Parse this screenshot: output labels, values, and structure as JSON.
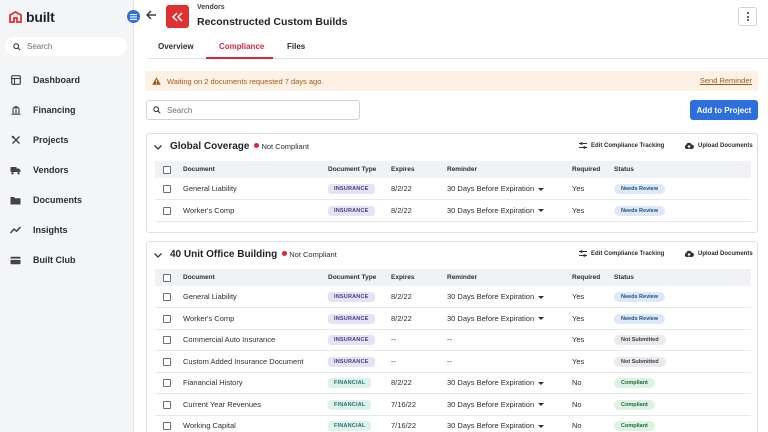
{
  "app": {
    "logo_text": "built"
  },
  "sidebar": {
    "search_placeholder": "Search",
    "items": [
      {
        "label": "Dashboard",
        "icon": "dashboard-icon"
      },
      {
        "label": "Financing",
        "icon": "bank-icon"
      },
      {
        "label": "Projects",
        "icon": "tools-icon"
      },
      {
        "label": "Vendors",
        "icon": "truck-icon"
      },
      {
        "label": "Documents",
        "icon": "folder-icon"
      },
      {
        "label": "Insights",
        "icon": "chart-icon"
      },
      {
        "label": "Built Club",
        "icon": "card-icon"
      }
    ]
  },
  "header": {
    "breadcrumb": "Vendors",
    "title": "Reconstructed Custom Builds"
  },
  "tabs": [
    {
      "label": "Overview",
      "active": false
    },
    {
      "label": "Compliance",
      "active": true
    },
    {
      "label": "Files",
      "active": false
    }
  ],
  "alert": {
    "message": "Waiting on 2 documents requested 7 days ago.",
    "link": "Send Reminder"
  },
  "toolbar": {
    "search_placeholder": "Search",
    "add_label": "Add to Project"
  },
  "columns": [
    "Document",
    "Document Type",
    "Expires",
    "Reminder",
    "Required",
    "Status"
  ],
  "actions": {
    "edit": "Edit Compliance Tracking",
    "upload": "Upload Documents"
  },
  "projects": [
    {
      "name": "Global Coverage",
      "status": "Not Compliant",
      "rows": [
        {
          "document": "General Liability",
          "type": "INSURANCE",
          "expires": "8/2/22",
          "reminder": "30 Days Before Expiration",
          "required": "Yes",
          "status": "Needs Review"
        },
        {
          "document": "Worker's Comp",
          "type": "INSURANCE",
          "expires": "8/2/22",
          "reminder": "30 Days Before Expiration",
          "required": "Yes",
          "status": "Needs Review"
        }
      ]
    },
    {
      "name": "40 Unit Office Building",
      "status": "Not Compliant",
      "rows": [
        {
          "document": "General Liability",
          "type": "INSURANCE",
          "expires": "8/2/22",
          "reminder": "30 Days Before Expiration",
          "required": "Yes",
          "status": "Needs Review"
        },
        {
          "document": "Worker's Comp",
          "type": "INSURANCE",
          "expires": "8/2/22",
          "reminder": "30 Days Before Expiration",
          "required": "Yes",
          "status": "Needs Review"
        },
        {
          "document": "Commercial Auto Insurance",
          "type": "INSURANCE",
          "expires": "--",
          "reminder": "--",
          "required": "Yes",
          "status": "Not Submitted"
        },
        {
          "document": "Custom Added Insurance Document",
          "type": "INSURANCE",
          "expires": "--",
          "reminder": "--",
          "required": "Yes",
          "status": "Not Submitted"
        },
        {
          "document": "Fianancial History",
          "type": "FINANCIAL",
          "expires": "8/2/22",
          "reminder": "30 Days Before Expiration",
          "required": "No",
          "status": "Compliant"
        },
        {
          "document": "Current Year Revenues",
          "type": "FINANCIAL",
          "expires": "7/16/22",
          "reminder": "30 Days Before Expiration",
          "required": "No",
          "status": "Compliant"
        },
        {
          "document": "Working Capital",
          "type": "FINANCIAL",
          "expires": "7/16/22",
          "reminder": "30 Days Before Expiration",
          "required": "No",
          "status": "Compliant"
        }
      ]
    }
  ],
  "colors": {
    "brand_red": "#e03131",
    "accent_blue": "#2d6fdb",
    "tab_active": "#d7263d"
  }
}
